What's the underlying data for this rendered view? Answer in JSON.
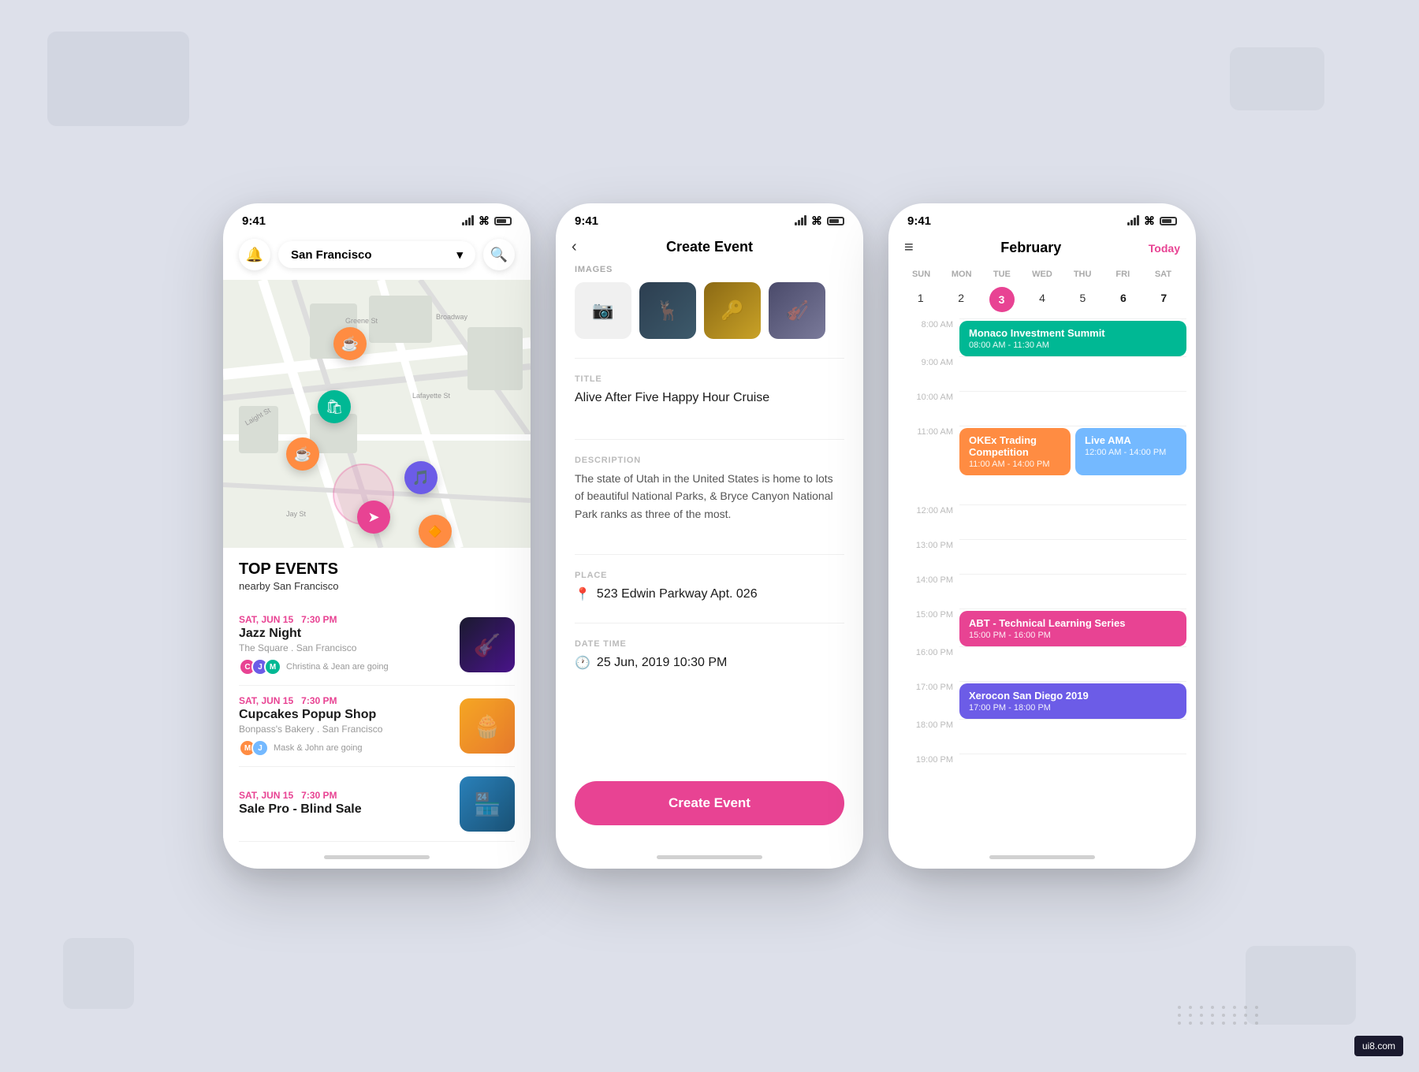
{
  "background": {
    "color": "#dde0ea"
  },
  "watermark": {
    "text": "ui8.com"
  },
  "phone1": {
    "statusBar": {
      "time": "9:41"
    },
    "header": {
      "location": "San Francisco",
      "dropdownArrow": "▾"
    },
    "topEvents": {
      "title": "TOP EVENTS",
      "subtitle_pre": "nearby",
      "subtitle_city": "San Francisco"
    },
    "events": [
      {
        "date": "SAT, JUN 15",
        "time": "7:30 PM",
        "name": "Jazz Night",
        "venue": "The Square . San Francisco",
        "attendees": "Christina & Jean are going"
      },
      {
        "date": "SAT, JUN 15",
        "time": "7:30 PM",
        "name": "Cupcakes Popup Shop",
        "venue": "Bonpass's Bakery . San Francisco",
        "attendees": "Mask & John are going"
      },
      {
        "date": "SAT, JUN 15",
        "time": "7:30 PM",
        "name": "Sale Pro - Blind Sale",
        "venue": "",
        "attendees": ""
      }
    ],
    "mapPins": [
      {
        "type": "coffee",
        "emoji": "☕",
        "color": "#ff8c42"
      },
      {
        "type": "shop",
        "emoji": "🛍",
        "color": "#00b894"
      },
      {
        "type": "coffee2",
        "emoji": "☕",
        "color": "#ff8c42"
      },
      {
        "type": "music",
        "emoji": "🎵",
        "color": "#6c5ce7"
      },
      {
        "type": "nav",
        "emoji": "➤",
        "color": "#e84393"
      },
      {
        "type": "orange",
        "emoji": "🍊",
        "color": "#ff8c42"
      }
    ]
  },
  "phone2": {
    "statusBar": {
      "time": "9:41"
    },
    "header": {
      "backArrow": "‹",
      "title": "Create Event"
    },
    "form": {
      "imagesLabel": "IMAGES",
      "uploadPlaceholder": "📷",
      "titleLabel": "TITLE",
      "titleValue": "Alive After Five Happy Hour Cruise",
      "descriptionLabel": "DESCRIPTION",
      "descriptionValue": "The state of Utah in the United States is home to lots of beautiful National Parks, & Bryce Canyon National Park ranks as three of the most.",
      "placeLabel": "PLACE",
      "placeIcon": "📍",
      "placeValue": "523 Edwin Parkway Apt. 026",
      "dateTimeLabel": "DATE TIME",
      "dateTimeIcon": "🕐",
      "dateTimeValue": "25 Jun, 2019 10:30 PM"
    },
    "createButton": "Create Event"
  },
  "phone3": {
    "statusBar": {
      "time": "9:41"
    },
    "header": {
      "menuIcon": "≡",
      "month": "February",
      "todayBtn": "Today"
    },
    "calendar": {
      "dayHeaders": [
        "SUN",
        "MON",
        "TUE",
        "WED",
        "THU",
        "FRI",
        "SAT"
      ],
      "days": [
        {
          "num": "1",
          "style": "normal"
        },
        {
          "num": "2",
          "style": "normal"
        },
        {
          "num": "3",
          "style": "today"
        },
        {
          "num": "4",
          "style": "normal"
        },
        {
          "num": "5",
          "style": "normal"
        },
        {
          "num": "6",
          "style": "bold"
        },
        {
          "num": "7",
          "style": "bold"
        }
      ]
    },
    "timeSlots": [
      {
        "time": "8:00 AM",
        "events": [
          {
            "title": "Monaco Investment Summit",
            "timeRange": "08:00 AM - 11:30 AM",
            "color": "monaco"
          }
        ]
      },
      {
        "time": "9:00 AM",
        "events": []
      },
      {
        "time": "10:00 AM",
        "events": []
      },
      {
        "time": "11:00 AM",
        "events": [
          {
            "title": "OKEx Trading Competition",
            "timeRange": "11:00 AM - 14:00 PM",
            "color": "okex"
          },
          {
            "title": "Live AMA",
            "timeRange": "12:00 AM - 14:00 PM",
            "color": "live-ama"
          }
        ]
      },
      {
        "time": "12:00 AM",
        "events": []
      },
      {
        "time": "13:00 PM",
        "events": []
      },
      {
        "time": "14:00 PM",
        "events": []
      },
      {
        "time": "15:00 PM",
        "events": [
          {
            "title": "ABT - Technical Learning Series",
            "timeRange": "15:00 PM - 16:00 PM",
            "color": "abt"
          }
        ]
      },
      {
        "time": "16:00 PM",
        "events": []
      },
      {
        "time": "17:00 PM",
        "events": [
          {
            "title": "Xerocon San Diego 2019",
            "timeRange": "17:00 PM - 18:00 PM",
            "color": "xerocon"
          }
        ]
      },
      {
        "time": "18:00 PM",
        "events": []
      },
      {
        "time": "19:00 PM",
        "events": []
      }
    ]
  }
}
